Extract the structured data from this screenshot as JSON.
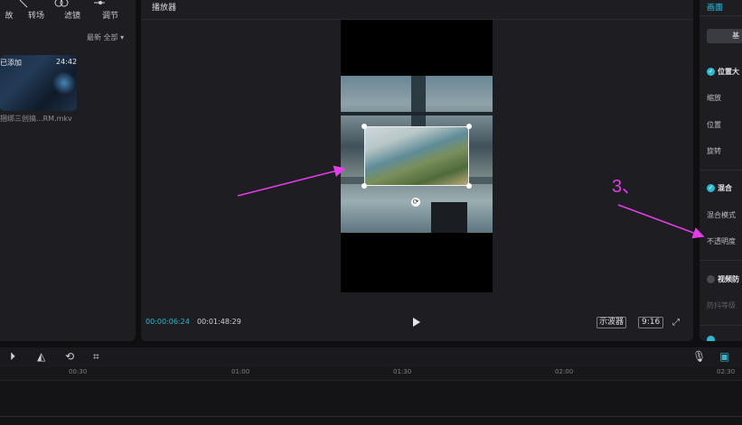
{
  "media_panel": {
    "tools": [
      "故",
      "转场",
      "滤镜",
      "调节"
    ],
    "sort_label": "最新",
    "filter_label": "全部",
    "clip": {
      "added_label": "已添加",
      "duration": "24:42",
      "filename": "捆绑三创搞...RM.mkv"
    }
  },
  "player": {
    "title": "播放器",
    "time_current": "00:00:06:24",
    "time_total": "00:01:48:29",
    "waveform_button": "示波器",
    "ratio_button": "9:16"
  },
  "props": {
    "tab_picture": "画面",
    "basic_tab": "基",
    "section_position": "位置大",
    "label_scale": "缩放",
    "label_position": "位置",
    "label_rotate": "旋转",
    "section_blend": "混合",
    "label_blend_mode": "混合模式",
    "label_opacity": "不透明度",
    "section_stabilize": "视频防",
    "label_stabilize_level": "防抖等级"
  },
  "timeline": {
    "ticks": [
      "00:30",
      "01:00",
      "01:30",
      "02:00",
      "02:30"
    ]
  },
  "annotation": {
    "step_label": "3、",
    "color": "#e43ce6"
  },
  "colors": {
    "accent": "#2fb7cf",
    "panel": "#1e1e22",
    "background": "#0f0f12"
  }
}
